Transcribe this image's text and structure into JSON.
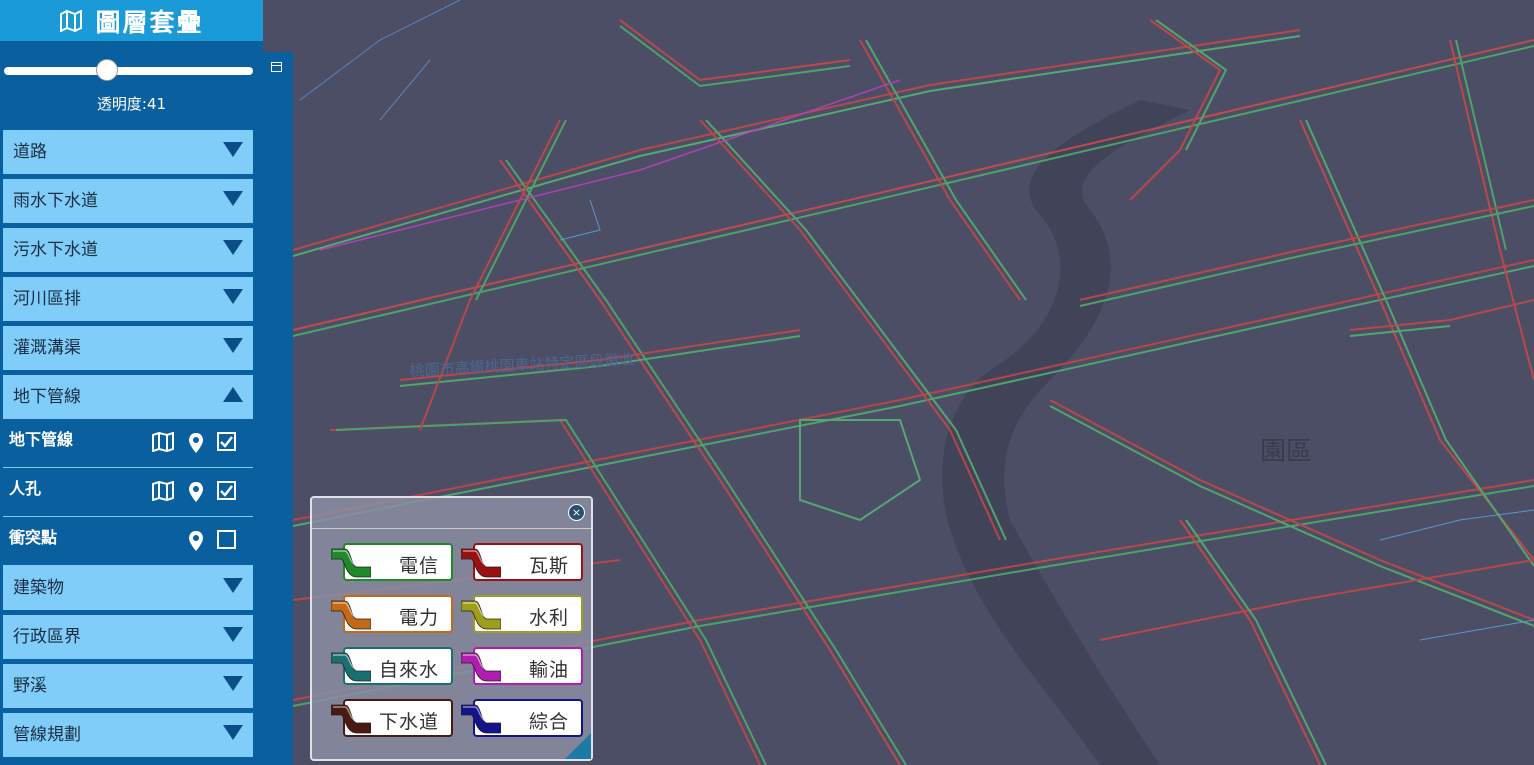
{
  "panel": {
    "title": "圖層套疊",
    "opacity_text": "透明度:41",
    "opacity_value": 41
  },
  "layers": {
    "roads": "道路",
    "stormwater": "雨水下水道",
    "sewer": "污水下水道",
    "river": "河川區排",
    "irrigation": "灌溉溝渠",
    "underground": "地下管線",
    "buildings": "建築物",
    "admin": "行政區界",
    "streams": "野溪",
    "pipeline_plan": "管線規劃"
  },
  "sublayers": [
    {
      "label": "地下管線",
      "checked": true
    },
    {
      "label": "人孔",
      "checked": true
    },
    {
      "label": "衝突點",
      "checked": false
    }
  ],
  "legend": [
    {
      "label": "電信",
      "color": "#1f8a2a"
    },
    {
      "label": "瓦斯",
      "color": "#9b1010"
    },
    {
      "label": "電力",
      "color": "#c46a14"
    },
    {
      "label": "水利",
      "color": "#9e9e1a"
    },
    {
      "label": "自來水",
      "color": "#1a7070"
    },
    {
      "label": "輸油",
      "color": "#b11cb1"
    },
    {
      "label": "下水道",
      "color": "#4a1a12"
    },
    {
      "label": "綜合",
      "color": "#13138e"
    }
  ],
  "map_labels": {
    "district": "園區",
    "road1": "桃園市高鐵桃園車站特定區段徵收"
  }
}
